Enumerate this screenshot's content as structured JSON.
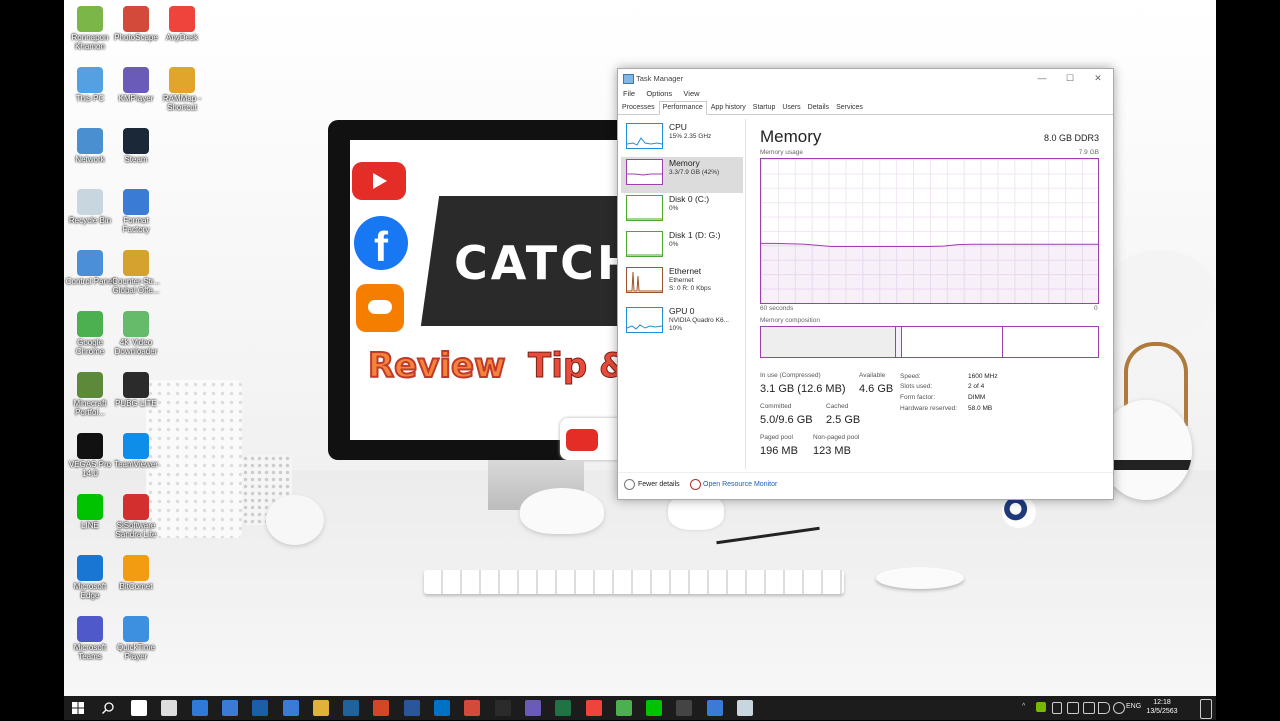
{
  "desktop_icons": [
    {
      "label": "Ronnapon Khamon",
      "color": "#7ab648"
    },
    {
      "label": "PhotoScape",
      "color": "#d44a3a"
    },
    {
      "label": "AnyDesk",
      "color": "#ef443b"
    },
    {
      "label": "This PC",
      "color": "#55a0e0"
    },
    {
      "label": "KMPlayer",
      "color": "#6b5bb8"
    },
    {
      "label": "RAMMap - Shortcut",
      "color": "#e0a52a"
    },
    {
      "label": "Network",
      "color": "#4a90d0"
    },
    {
      "label": "Steam",
      "color": "#1b2838"
    },
    {
      "label": "Recycle Bin",
      "color": "#c8d6e0"
    },
    {
      "label": "Format Factory",
      "color": "#3a7bd5"
    },
    {
      "label": "Control Panel",
      "color": "#4a8fd8"
    },
    {
      "label": "Counter-Str... Global Offe...",
      "color": "#d5a12f"
    },
    {
      "label": "Google Chrome",
      "color": "#4caf50"
    },
    {
      "label": "4K Video Downloader",
      "color": "#66bb6a"
    },
    {
      "label": "Minecraft Portfol...",
      "color": "#5d8a3a"
    },
    {
      "label": "PUBG LITE",
      "color": "#2b2b2b"
    },
    {
      "label": "VEGAS Pro 14.0",
      "color": "#111111"
    },
    {
      "label": "TeamViewer",
      "color": "#0e8ee9"
    },
    {
      "label": "LINE",
      "color": "#00c300"
    },
    {
      "label": "SiSoftware Sandra Lite",
      "color": "#d32f2f"
    },
    {
      "label": "Microsoft Edge",
      "color": "#1976d2"
    },
    {
      "label": "BitComet",
      "color": "#f39c12"
    },
    {
      "label": "Microsoft Teams",
      "color": "#5059c9"
    },
    {
      "label": "QuickTime Player",
      "color": "#3d8fe0"
    }
  ],
  "task_manager": {
    "title": "Task Manager",
    "menu": [
      "File",
      "Options",
      "View"
    ],
    "tabs": [
      "Processes",
      "Performance",
      "App history",
      "Startup",
      "Users",
      "Details",
      "Services"
    ],
    "active_tab": "Performance",
    "resources": [
      {
        "name": "CPU",
        "sub1": "15% 2.35 GHz",
        "sub2": "",
        "color": "#1f8fd8"
      },
      {
        "name": "Memory",
        "sub1": "3.3/7.9 GB (42%)",
        "sub2": "",
        "color": "#9d3fb0"
      },
      {
        "name": "Disk 0 (C:)",
        "sub1": "0%",
        "sub2": "",
        "color": "#4da832"
      },
      {
        "name": "Disk 1 (D: G:)",
        "sub1": "0%",
        "sub2": "",
        "color": "#4da832"
      },
      {
        "name": "Ethernet",
        "sub1": "Ethernet",
        "sub2": "S: 0 R: 0 Kbps",
        "color": "#a0522d"
      },
      {
        "name": "GPU 0",
        "sub1": "NVIDIA Quadro K6...",
        "sub2": "10%",
        "color": "#1f8fd8"
      }
    ],
    "memory": {
      "title": "Memory",
      "spec": "8.0 GB DDR3",
      "usage_label": "Memory usage",
      "usage_max": "7.9 GB",
      "time_left": "60 seconds",
      "time_right": "0",
      "composition_label": "Memory composition",
      "stats": {
        "in_use_label": "In use (Compressed)",
        "in_use": "3.1 GB (12.6 MB)",
        "available_label": "Available",
        "available": "4.6 GB",
        "committed_label": "Committed",
        "committed": "5.0/9.6 GB",
        "cached_label": "Cached",
        "cached": "2.5 GB",
        "paged_label": "Paged pool",
        "paged": "196 MB",
        "nonpaged_label": "Non-paged pool",
        "nonpaged": "123 MB"
      },
      "details": [
        {
          "k": "Speed:",
          "v": "1600 MHz"
        },
        {
          "k": "Slots used:",
          "v": "2 of 4"
        },
        {
          "k": "Form factor:",
          "v": "DIMM"
        },
        {
          "k": "Hardware reserved:",
          "v": "58.0 MB"
        }
      ],
      "usage_history_gb": [
        3.27,
        3.27,
        3.25,
        3.23,
        3.17,
        3.1,
        3.1,
        3.1,
        3.1,
        3.1,
        3.1,
        3.1,
        3.1,
        3.12,
        3.2,
        3.22,
        3.22,
        3.22,
        3.22,
        3.22,
        3.22,
        3.22,
        3.22,
        3.22,
        3.22
      ]
    },
    "footer": {
      "fewer": "Fewer details",
      "monitor": "Open Resource Monitor"
    }
  },
  "screen_art": {
    "catch": "CATCH",
    "review": "Review",
    "tip": "Tip &"
  },
  "taskbar": {
    "apps": [
      "#ffffff",
      "#dddddd",
      "#2f7ad9",
      "#3a7bd5",
      "#1a5fa8",
      "#3a7bd5",
      "#e0b23a",
      "#20639b",
      "#d24726",
      "#2b579a",
      "#0072c6",
      "#d44a3a",
      "#2b2b2b",
      "#6b5bb8",
      "#217346",
      "#ef443b",
      "#4caf50",
      "#00c300",
      "#444444",
      "#3a7bd5",
      "#c8d6e0"
    ],
    "lang": "ENG",
    "time": "12:18",
    "date": "13/5/2563"
  }
}
